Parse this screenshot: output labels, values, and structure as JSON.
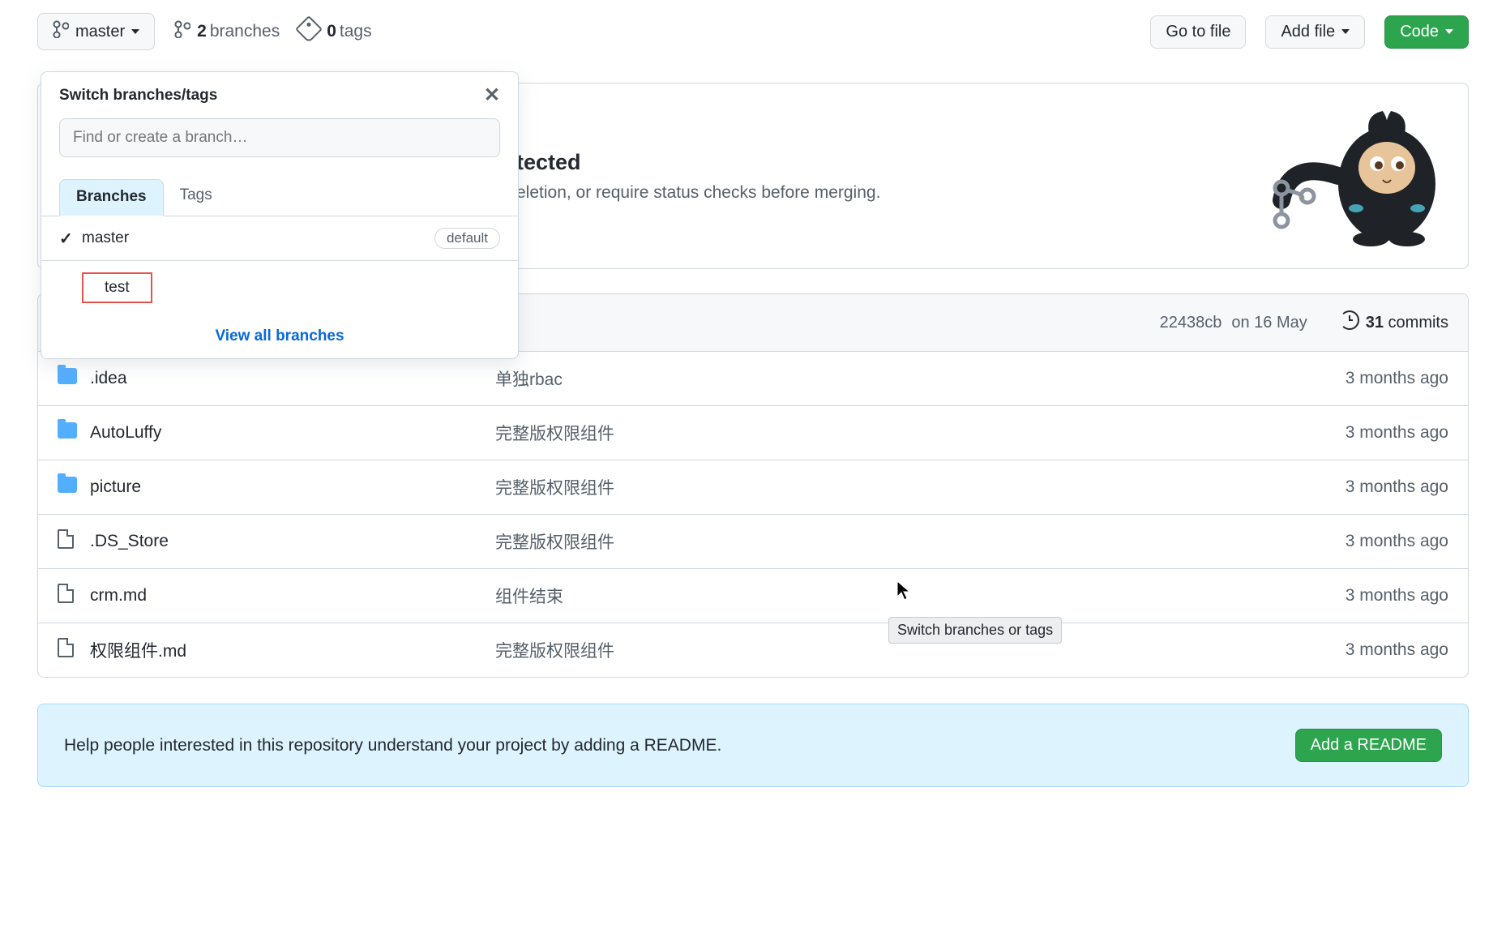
{
  "toolbar": {
    "branch_btn": "master",
    "branches_count": "2",
    "branches_label": "branches",
    "tags_count": "0",
    "tags_label": "tags",
    "go_to_file": "Go to file",
    "add_file": "Add file",
    "code": "Code"
  },
  "popover": {
    "title": "Switch branches/tags",
    "search_placeholder": "Find or create a branch…",
    "tab_branches": "Branches",
    "tab_tags": "Tags",
    "branches": [
      {
        "name": "master",
        "checked": true,
        "default": true,
        "highlighted": false
      },
      {
        "name": "test",
        "checked": false,
        "default": false,
        "highlighted": true
      }
    ],
    "default_badge": "default",
    "view_all": "View all branches"
  },
  "protect": {
    "title_suffix": "tected",
    "subtitle_suffix": "eletion, or require status checks before merging."
  },
  "commits": {
    "sha": "22438cb",
    "date": "on 16 May",
    "count": "31",
    "label": "commits"
  },
  "files": [
    {
      "type": "dir",
      "name": ".idea",
      "msg": "单独rbac",
      "age": "3 months ago"
    },
    {
      "type": "dir",
      "name": "AutoLuffy",
      "msg": "完整版权限组件",
      "age": "3 months ago"
    },
    {
      "type": "dir",
      "name": "picture",
      "msg": "完整版权限组件",
      "age": "3 months ago"
    },
    {
      "type": "file",
      "name": ".DS_Store",
      "msg": "完整版权限组件",
      "age": "3 months ago"
    },
    {
      "type": "file",
      "name": "crm.md",
      "msg": "组件结束",
      "age": "3 months ago"
    },
    {
      "type": "file",
      "name": "权限组件.md",
      "msg": "完整版权限组件",
      "age": "3 months ago"
    }
  ],
  "readme": {
    "prompt": "Help people interested in this repository understand your project by adding a README.",
    "button": "Add a README"
  },
  "tooltip": "Switch branches or tags"
}
